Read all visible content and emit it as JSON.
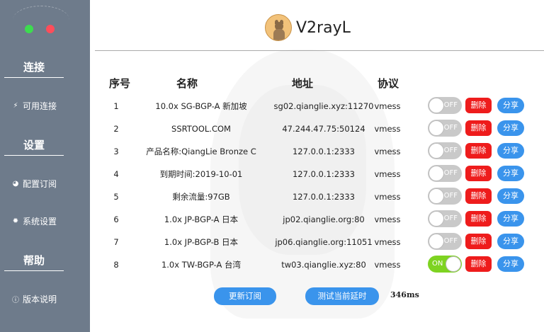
{
  "app": {
    "title": "V2rayL"
  },
  "sidebar": {
    "sections": [
      {
        "title": "连接",
        "items": [
          {
            "label": "可用连接",
            "icon": "plug-icon"
          }
        ]
      },
      {
        "title": "设置",
        "items": [
          {
            "label": "配置订阅",
            "icon": "gauge-icon"
          },
          {
            "label": "系统设置",
            "icon": "gear-icon"
          }
        ]
      },
      {
        "title": "帮助",
        "items": [
          {
            "label": "版本说明",
            "icon": "info-icon"
          }
        ]
      }
    ]
  },
  "table": {
    "headers": {
      "no": "序号",
      "name": "名称",
      "address": "地址",
      "protocol": "协议"
    },
    "delete_label": "删除",
    "share_label": "分享",
    "toggle_on_label": "ON",
    "toggle_off_label": "OFF",
    "rows": [
      {
        "no": "1",
        "name": "10.0x SG-BGP-A 新加坡",
        "address": "sg02.qianglie.xyz:11270",
        "protocol": "vmess",
        "enabled": false
      },
      {
        "no": "2",
        "name": "SSRTOOL.COM",
        "address": "47.244.47.75:50124",
        "protocol": "vmess",
        "enabled": false
      },
      {
        "no": "3",
        "name": "产品名称:QiangLie Bronze C",
        "address": "127.0.0.1:2333",
        "protocol": "vmess",
        "enabled": false
      },
      {
        "no": "4",
        "name": "到期时间:2019-10-01",
        "address": "127.0.0.1:2333",
        "protocol": "vmess",
        "enabled": false
      },
      {
        "no": "5",
        "name": "剩余流量:97GB",
        "address": "127.0.0.1:2333",
        "protocol": "vmess",
        "enabled": false
      },
      {
        "no": "6",
        "name": "1.0x JP-BGP-A 日本",
        "address": "jp02.qianglie.org:80",
        "protocol": "vmess",
        "enabled": false
      },
      {
        "no": "7",
        "name": "1.0x JP-BGP-B 日本",
        "address": "jp06.qianglie.org:11051",
        "protocol": "vmess",
        "enabled": false
      },
      {
        "no": "8",
        "name": "1.0x TW-BGP-A 台湾",
        "address": "tw03.qianglie.xyz:80",
        "protocol": "vmess",
        "enabled": true
      }
    ]
  },
  "footer": {
    "update_button": "更新订阅",
    "latency_button": "测试当前延时",
    "latency_value": "346ms"
  },
  "colors": {
    "sidebar_bg": "#6e7b8b",
    "accent_blue": "#3a94ec",
    "delete_red": "#ee1c1c",
    "toggle_on": "#7ed321",
    "toggle_off": "#c9c9c9"
  }
}
